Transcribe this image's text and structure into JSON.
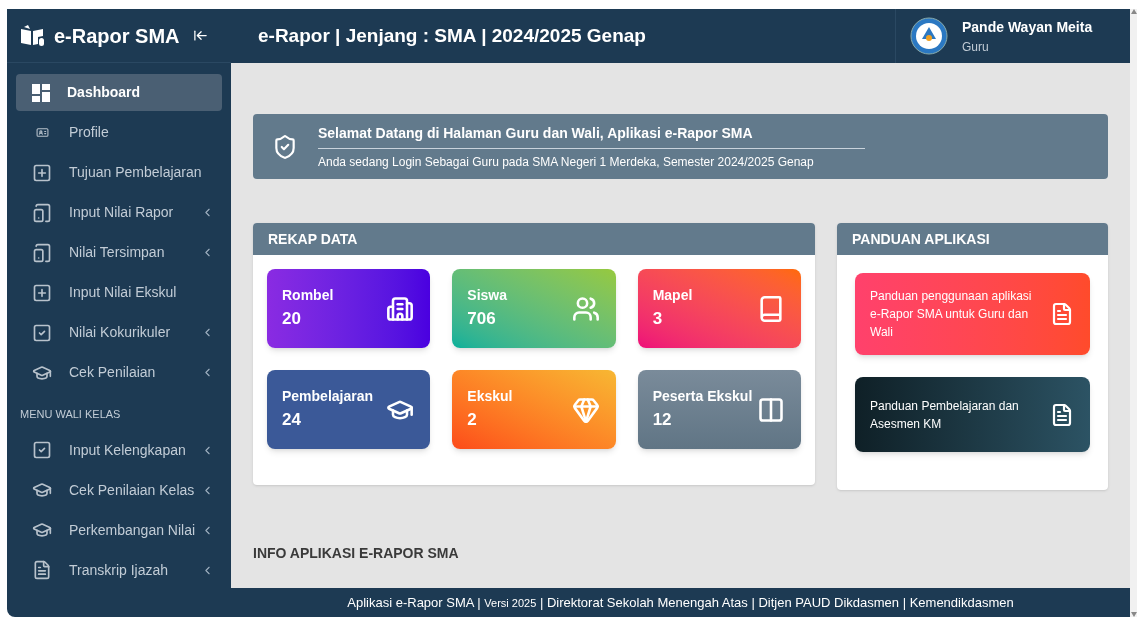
{
  "brand": {
    "name": "e-Rapor SMA"
  },
  "header": {
    "title": "e-Rapor | Jenjang : SMA | 2024/2025 Genap",
    "user": {
      "name": "Pande Wayan Meita",
      "role": "Guru"
    }
  },
  "sidebar": {
    "sections": [
      {
        "items": [
          {
            "label": "Dashboard",
            "selected": true,
            "has_submenu": false
          },
          {
            "label": "Profile",
            "selected": false,
            "has_submenu": false
          },
          {
            "label": "Tujuan Pembelajaran",
            "selected": false,
            "has_submenu": false
          },
          {
            "label": "Input Nilai Rapor",
            "selected": false,
            "has_submenu": true
          },
          {
            "label": "Nilai Tersimpan",
            "selected": false,
            "has_submenu": true
          },
          {
            "label": "Input Nilai Ekskul",
            "selected": false,
            "has_submenu": false
          },
          {
            "label": "Nilai Kokurikuler",
            "selected": false,
            "has_submenu": true
          },
          {
            "label": "Cek Penilaian",
            "selected": false,
            "has_submenu": true
          }
        ]
      },
      {
        "heading": "MENU WALI KELAS",
        "items": [
          {
            "label": "Input Kelengkapan",
            "selected": false,
            "has_submenu": true
          },
          {
            "label": "Cek Penilaian Kelas",
            "selected": false,
            "has_submenu": true
          },
          {
            "label": "Perkembangan Nilai",
            "selected": false,
            "has_submenu": true
          },
          {
            "label": "Transkrip Ijazah",
            "selected": false,
            "has_submenu": true
          }
        ]
      }
    ]
  },
  "welcome": {
    "title": "Selamat Datang di Halaman Guru dan Wali, Aplikasi e-Rapor SMA",
    "subtitle": "Anda sedang Login Sebagai Guru pada SMA Negeri 1 Merdeka, Semester 2024/2025 Genap"
  },
  "rekap": {
    "title": "REKAP DATA",
    "cards": [
      {
        "label": "Rombel",
        "value": "20"
      },
      {
        "label": "Siswa",
        "value": "706"
      },
      {
        "label": "Mapel",
        "value": "3"
      },
      {
        "label": "Pembelajaran",
        "value": "24"
      },
      {
        "label": "Ekskul",
        "value": "2"
      },
      {
        "label": "Peserta Ekskul",
        "value": "12"
      }
    ]
  },
  "panduan": {
    "title": "PANDUAN APLIKASI",
    "links": [
      {
        "label": "Panduan penggunaan aplikasi e-Rapor SMA untuk Guru dan Wali"
      },
      {
        "label": "Panduan Pembelajaran dan Asesmen KM"
      }
    ]
  },
  "info": {
    "title": "INFO APLIKASI E-RAPOR SMA"
  },
  "footer": {
    "parts": [
      {
        "text": "Aplikasi e-Rapor SMA | ",
        "small": false
      },
      {
        "text": "Versi 2025",
        "small": true
      },
      {
        "text": " | Direktorat Sekolah Menengah Atas | Ditjen PAUD Dikdasmen | Kemendikdasmen",
        "small": false
      }
    ]
  }
}
